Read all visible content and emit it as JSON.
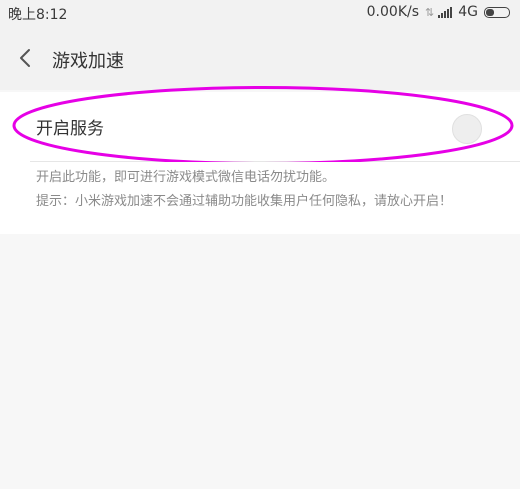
{
  "status_bar": {
    "time": "晚上8:12",
    "network_speed": "0.00K/s",
    "network_type": "4G",
    "icons": [
      "data-arrows-icon",
      "signal-icon",
      "battery-icon"
    ]
  },
  "header": {
    "title": "游戏加速",
    "back_icon": "chevron-left-icon"
  },
  "service": {
    "label": "开启服务",
    "enabled": false
  },
  "description": {
    "line1": "开启此功能，即可进行游戏模式微信电话勿扰功能。",
    "line2": "提示：小米游戏加速不会通过辅助功能收集用户任何隐私，请放心开启！"
  },
  "colors": {
    "highlight": "#e600e6",
    "background": "#f7f7f7",
    "row_background": "#ffffff"
  }
}
